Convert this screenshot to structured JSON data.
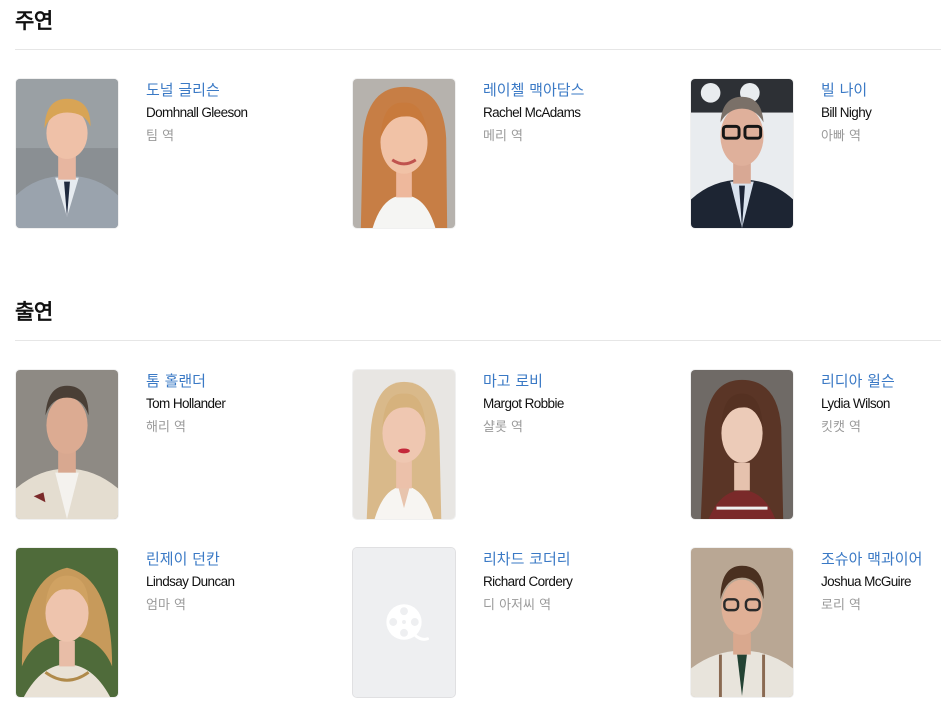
{
  "sections": [
    {
      "title": "주연",
      "people": [
        {
          "korean_name": "도널 글리슨",
          "english_name": "Domhnall Gleeson",
          "role": "팀 역",
          "photo": "portrait-photo"
        },
        {
          "korean_name": "레이첼 맥아담스",
          "english_name": "Rachel McAdams",
          "role": "메리 역",
          "photo": "portrait-photo"
        },
        {
          "korean_name": "빌 나이",
          "english_name": "Bill Nighy",
          "role": "아빠 역",
          "photo": "portrait-photo"
        }
      ]
    },
    {
      "title": "출연",
      "people": [
        {
          "korean_name": "톰 홀랜더",
          "english_name": "Tom Hollander",
          "role": "해리 역",
          "photo": "portrait-photo"
        },
        {
          "korean_name": "마고 로비",
          "english_name": "Margot Robbie",
          "role": "샬롯 역",
          "photo": "portrait-photo"
        },
        {
          "korean_name": "리디아 윌슨",
          "english_name": "Lydia Wilson",
          "role": "킷캣 역",
          "photo": "portrait-photo"
        },
        {
          "korean_name": "린제이 던칸",
          "english_name": "Lindsay Duncan",
          "role": "엄마 역",
          "photo": "portrait-photo"
        },
        {
          "korean_name": "리차드 코더리",
          "english_name": "Richard Cordery",
          "role": "디 아저씨 역",
          "photo": "film-reel-placeholder-icon"
        },
        {
          "korean_name": "조슈아 맥과이어",
          "english_name": "Joshua McGuire",
          "role": "로리 역",
          "photo": "portrait-photo"
        }
      ]
    }
  ],
  "colors": {
    "name_link": "#3a79c5",
    "role_text": "#9a9a9a",
    "divider": "#e6e6e6",
    "placeholder_bg": "#eeeff1"
  }
}
